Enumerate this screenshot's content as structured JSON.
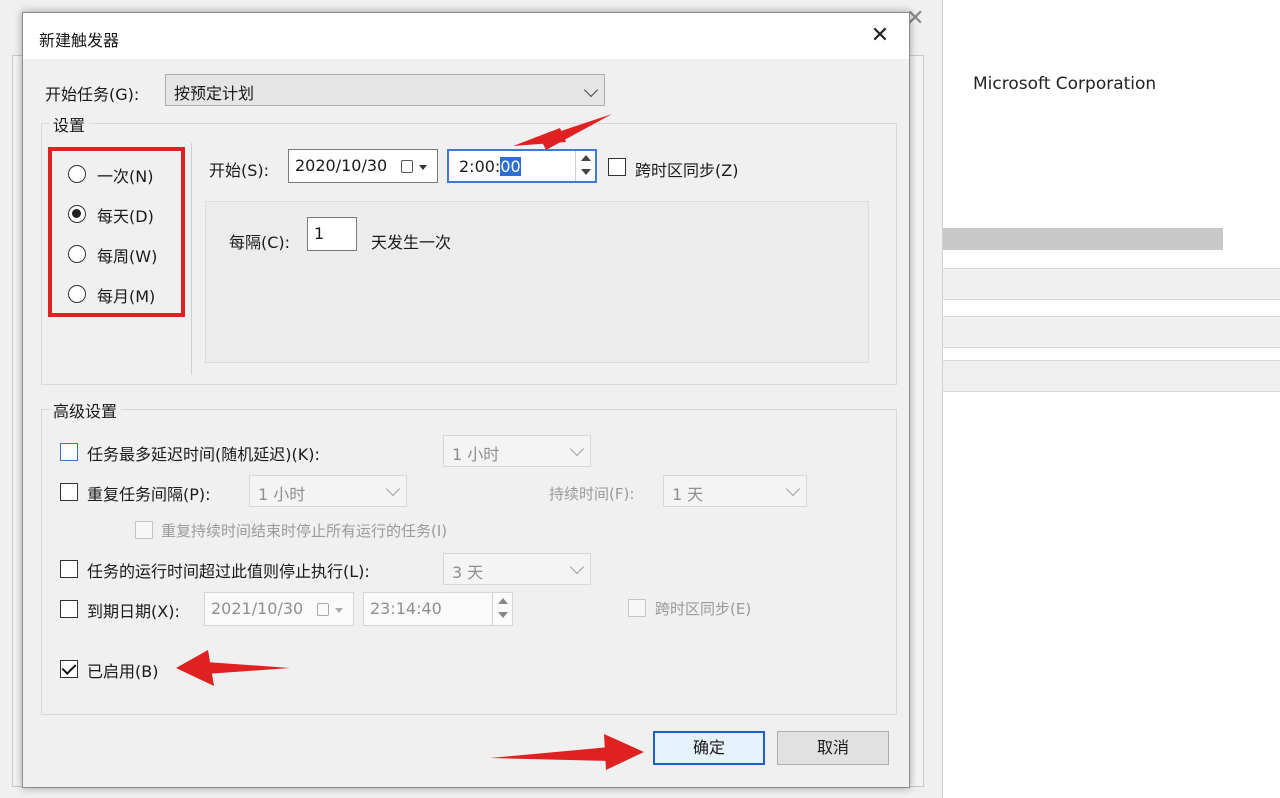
{
  "background": {
    "company": "Microsoft Corporation"
  },
  "dialog": {
    "title": "新建触发器",
    "begin_task_label": "开始任务(G):",
    "begin_task_value": "按预定计划",
    "settings_label": "设置",
    "radios": [
      {
        "label": "一次(N)",
        "selected": false
      },
      {
        "label": "每天(D)",
        "selected": true
      },
      {
        "label": "每周(W)",
        "selected": false
      },
      {
        "label": "每月(M)",
        "selected": false
      }
    ],
    "start_label": "开始(S):",
    "start_date": "2020/10/30",
    "start_time_prefix": "2:00:",
    "start_time_selected": "00",
    "sync_tz_label": "跨时区同步(Z)",
    "recur_label": "每隔(C):",
    "recur_value": "1",
    "recur_unit": "天发生一次",
    "advanced_label": "高级设置",
    "delay_label": "任务最多延迟时间(随机延迟)(K):",
    "delay_value": "1 小时",
    "repeat_label": "重复任务间隔(P):",
    "repeat_value": "1 小时",
    "duration_label": "持续时间(F):",
    "duration_value": "1 天",
    "stop_running_label": "重复持续时间结束时停止所有运行的任务(I)",
    "stop_longer_label": "任务的运行时间超过此值则停止执行(L):",
    "stop_longer_value": "3 天",
    "expire_label": "到期日期(X):",
    "expire_date": "2021/10/30",
    "expire_time": "23:14:40",
    "expire_sync_label": "跨时区同步(E)",
    "enabled_label": "已启用(B)",
    "ok_label": "确定",
    "cancel_label": "取消"
  },
  "colors": {
    "annotation_red": "#e02121",
    "focus_blue": "#3f7ad6"
  }
}
